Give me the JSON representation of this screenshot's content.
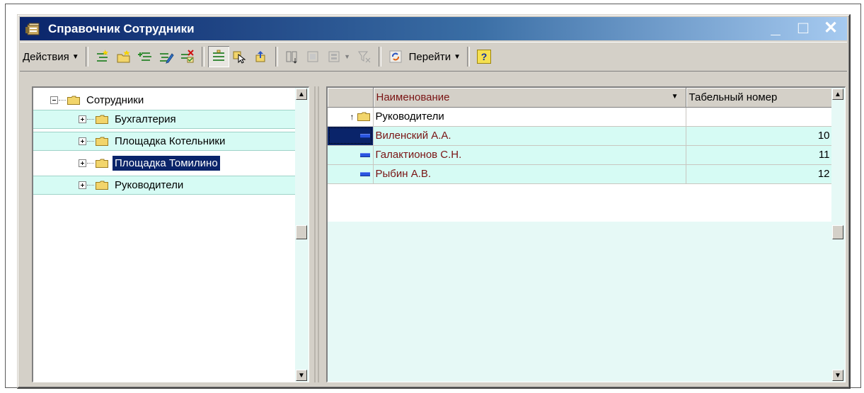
{
  "window": {
    "title": "Справочник Сотрудники",
    "min_glyph": "_",
    "max_glyph": "□",
    "close_glyph": "✕"
  },
  "toolbar": {
    "actions_label": "Действия",
    "goto_label": "Перейти",
    "help_glyph": "?"
  },
  "tree": {
    "root": "Сотрудники",
    "items": [
      {
        "label": "Бухгалтерия",
        "selected": false
      },
      {
        "label": "Площадка Котельники",
        "selected": false
      },
      {
        "label": "Площадка Томилино",
        "selected": true
      },
      {
        "label": "Руководители",
        "selected": false
      }
    ]
  },
  "table": {
    "columns": {
      "name": "Наименование",
      "number": "Табельный номер"
    },
    "group_row": {
      "name": "Руководители",
      "number": ""
    },
    "rows": [
      {
        "name": "Виленский А.А.",
        "number": "10",
        "selected": true
      },
      {
        "name": "Галактионов С.Н.",
        "number": "11",
        "selected": false
      },
      {
        "name": "Рыбин А.В.",
        "number": "12",
        "selected": false
      }
    ]
  },
  "colors": {
    "title_bar_start": "#0a246a",
    "title_bar_end": "#a6caf0",
    "row_highlight": "#d6fbf4",
    "name_text": "#7a1414",
    "selection": "#0a246a"
  }
}
